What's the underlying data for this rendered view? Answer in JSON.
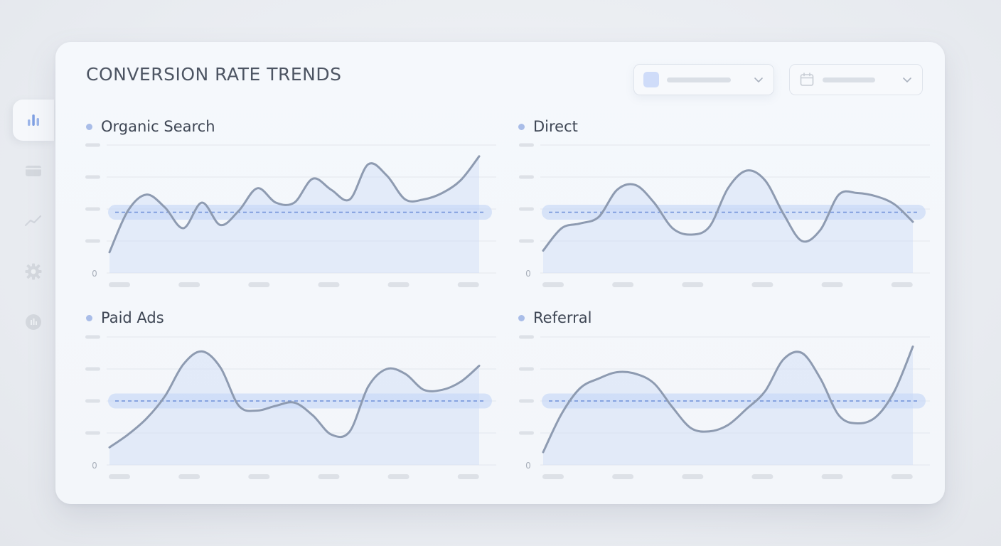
{
  "dashboard": {
    "title": "CONVERSION RATE TRENDS",
    "sidebar_icons": [
      "bar-chart-icon",
      "card-icon",
      "trend-icon",
      "gear-icon",
      "pie-icon"
    ],
    "filter_icons": [
      "color-swatch-icon",
      "calendar-icon",
      "chevron-down-icon"
    ]
  },
  "colors": {
    "line": "#8e9bb1",
    "fill": "#cfdcf6",
    "band": "#c3d5f7",
    "baseline": "#6f90d8",
    "accent": "#a9bde8"
  },
  "chart_data": [
    {
      "type": "area",
      "title": "Organic Search",
      "y_zero_label": "0",
      "ylim": [
        0,
        4
      ],
      "baseline": 1.9,
      "x": [
        0,
        0.5,
        1,
        1.5,
        2,
        2.5,
        3,
        3.5,
        4,
        4.5,
        5,
        5.5,
        6,
        6.5,
        7,
        7.5,
        8,
        8.5,
        9,
        9.5,
        10
      ],
      "values": [
        0.65,
        1.95,
        2.45,
        2.05,
        1.4,
        2.2,
        1.5,
        1.95,
        2.65,
        2.2,
        2.2,
        2.95,
        2.6,
        2.3,
        3.4,
        3.05,
        2.3,
        2.3,
        2.5,
        2.9,
        3.65
      ],
      "grid": true
    },
    {
      "type": "area",
      "title": "Direct",
      "y_zero_label": "0",
      "ylim": [
        0,
        4
      ],
      "baseline": 1.9,
      "x": [
        0,
        0.5,
        1,
        1.5,
        2,
        2.5,
        3,
        3.5,
        4,
        4.5,
        5,
        5.5,
        6,
        6.5,
        7,
        7.5,
        8,
        8.5,
        9,
        9.5,
        10
      ],
      "values": [
        0.7,
        1.4,
        1.55,
        1.75,
        2.6,
        2.75,
        2.2,
        1.4,
        1.2,
        1.45,
        2.65,
        3.2,
        2.9,
        1.85,
        1.0,
        1.35,
        2.45,
        2.5,
        2.4,
        2.15,
        1.6
      ],
      "grid": true
    },
    {
      "type": "area",
      "title": "Paid Ads",
      "y_zero_label": "0",
      "ylim": [
        0,
        4
      ],
      "baseline": 2.0,
      "x": [
        0,
        0.5,
        1,
        1.5,
        2,
        2.5,
        3,
        3.5,
        4,
        4.5,
        5,
        5.5,
        6,
        6.5,
        7,
        7.5,
        8,
        8.5,
        9,
        9.5,
        10
      ],
      "values": [
        0.55,
        0.95,
        1.45,
        2.15,
        3.15,
        3.55,
        3.05,
        1.85,
        1.7,
        1.85,
        1.95,
        1.55,
        0.95,
        1.05,
        2.45,
        3.0,
        2.85,
        2.35,
        2.35,
        2.6,
        3.1
      ],
      "grid": true
    },
    {
      "type": "area",
      "title": "Referral",
      "y_zero_label": "0",
      "ylim": [
        0,
        4
      ],
      "baseline": 2.0,
      "x": [
        0,
        0.5,
        1,
        1.5,
        2,
        2.5,
        3,
        3.5,
        4,
        4.5,
        5,
        5.5,
        6,
        6.5,
        7,
        7.5,
        8,
        8.5,
        9,
        9.5,
        10
      ],
      "values": [
        0.4,
        1.6,
        2.4,
        2.7,
        2.9,
        2.85,
        2.55,
        1.8,
        1.15,
        1.05,
        1.25,
        1.75,
        2.3,
        3.3,
        3.5,
        2.7,
        1.55,
        1.3,
        1.5,
        2.3,
        3.7
      ],
      "grid": true
    }
  ]
}
